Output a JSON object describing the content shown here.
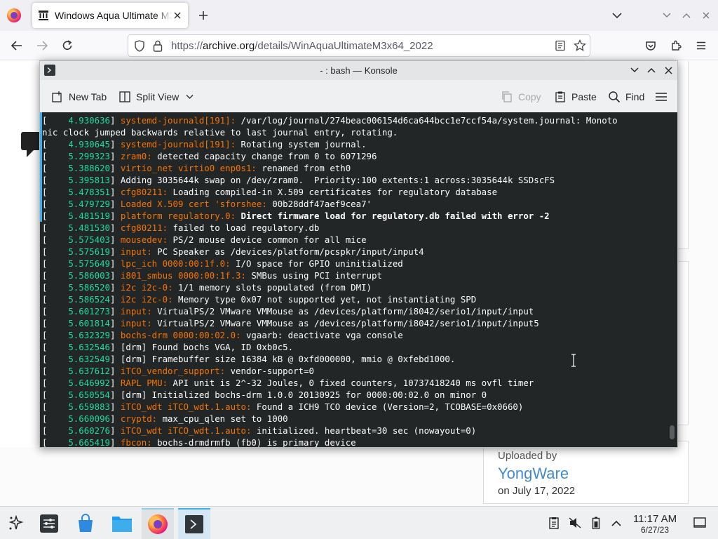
{
  "browser": {
    "tab_title": "Windows Aqua Ultimate M3x64_2022",
    "url_prefix": "https://",
    "url_domain": "archive.org",
    "url_path": "/details/WinAquaUltimateM3x64_2022"
  },
  "page": {
    "uploaded_by_label": "Uploaded by",
    "uploader": "YongWare",
    "upload_date": "on July 17, 2022"
  },
  "konsole": {
    "title": "- : bash — Konsole",
    "toolbar": {
      "new_tab": "New Tab",
      "split_view": "Split View",
      "copy": "Copy",
      "paste": "Paste",
      "find": "Find"
    },
    "lines": [
      [
        {
          "c": "w",
          "t": "[    "
        },
        {
          "c": "g",
          "t": "4.930636"
        },
        {
          "c": "w",
          "t": "] "
        },
        {
          "c": "o",
          "t": "systemd-journald[191]:"
        },
        {
          "c": "w",
          "t": " /var/log/journal/274beac006154d6ca644bcc1e7ccf54a/system.journal: Monoto"
        }
      ],
      [
        {
          "c": "w",
          "t": "nic clock jumped backwards relative to last journal entry, rotating."
        }
      ],
      [
        {
          "c": "w",
          "t": "[    "
        },
        {
          "c": "g",
          "t": "4.930645"
        },
        {
          "c": "w",
          "t": "] "
        },
        {
          "c": "o",
          "t": "systemd-journald[191]:"
        },
        {
          "c": "w",
          "t": " Rotating system journal."
        }
      ],
      [
        {
          "c": "w",
          "t": "[    "
        },
        {
          "c": "g",
          "t": "5.299323"
        },
        {
          "c": "w",
          "t": "] "
        },
        {
          "c": "o",
          "t": "zram0:"
        },
        {
          "c": "w",
          "t": " detected capacity change from 0 to 6071296"
        }
      ],
      [
        {
          "c": "w",
          "t": "[    "
        },
        {
          "c": "g",
          "t": "5.388620"
        },
        {
          "c": "w",
          "t": "] "
        },
        {
          "c": "o",
          "t": "virtio_net virtio0 enp0s1:"
        },
        {
          "c": "w",
          "t": " renamed from eth0"
        }
      ],
      [
        {
          "c": "w",
          "t": "[    "
        },
        {
          "c": "g",
          "t": "5.395813"
        },
        {
          "c": "w",
          "t": "] Adding 3035644k swap on /dev/zram0.  Priority:100 extents:1 across:3035644k SSDscFS"
        }
      ],
      [
        {
          "c": "w",
          "t": "[    "
        },
        {
          "c": "g",
          "t": "5.478351"
        },
        {
          "c": "w",
          "t": "] "
        },
        {
          "c": "o",
          "t": "cfg80211:"
        },
        {
          "c": "w",
          "t": " Loading compiled-in X.509 certificates for regulatory database"
        }
      ],
      [
        {
          "c": "w",
          "t": "[    "
        },
        {
          "c": "g",
          "t": "5.479729"
        },
        {
          "c": "w",
          "t": "] "
        },
        {
          "c": "o",
          "t": "Loaded X.509 cert 'sforshee:"
        },
        {
          "c": "w",
          "t": " 00b28ddf47aef9cea7'"
        }
      ],
      [
        {
          "c": "w",
          "t": "[    "
        },
        {
          "c": "g",
          "t": "5.481519"
        },
        {
          "c": "w",
          "t": "] "
        },
        {
          "c": "o",
          "t": "platform regulatory.0:"
        },
        {
          "c": "b",
          "t": " Direct firmware load for regulatory.db failed with error -2"
        }
      ],
      [
        {
          "c": "w",
          "t": "[    "
        },
        {
          "c": "g",
          "t": "5.481530"
        },
        {
          "c": "w",
          "t": "] "
        },
        {
          "c": "o",
          "t": "cfg80211:"
        },
        {
          "c": "w",
          "t": " failed to load regulatory.db"
        }
      ],
      [
        {
          "c": "w",
          "t": "[    "
        },
        {
          "c": "g",
          "t": "5.575403"
        },
        {
          "c": "w",
          "t": "] "
        },
        {
          "c": "o",
          "t": "mousedev:"
        },
        {
          "c": "w",
          "t": " PS/2 mouse device common for all mice"
        }
      ],
      [
        {
          "c": "w",
          "t": "[    "
        },
        {
          "c": "g",
          "t": "5.575619"
        },
        {
          "c": "w",
          "t": "] "
        },
        {
          "c": "o",
          "t": "input:"
        },
        {
          "c": "w",
          "t": " PC Speaker as /devices/platform/pcspkr/input/input4"
        }
      ],
      [
        {
          "c": "w",
          "t": "[    "
        },
        {
          "c": "g",
          "t": "5.575649"
        },
        {
          "c": "w",
          "t": "] "
        },
        {
          "c": "o",
          "t": "lpc_ich 0000:00:1f.0:"
        },
        {
          "c": "w",
          "t": " I/O space for GPIO uninitialized"
        }
      ],
      [
        {
          "c": "w",
          "t": "[    "
        },
        {
          "c": "g",
          "t": "5.586003"
        },
        {
          "c": "w",
          "t": "] "
        },
        {
          "c": "o",
          "t": "i801_smbus 0000:00:1f.3:"
        },
        {
          "c": "w",
          "t": " SMBus using PCI interrupt"
        }
      ],
      [
        {
          "c": "w",
          "t": "[    "
        },
        {
          "c": "g",
          "t": "5.586520"
        },
        {
          "c": "w",
          "t": "] "
        },
        {
          "c": "o",
          "t": "i2c i2c-0:"
        },
        {
          "c": "w",
          "t": " 1/1 memory slots populated (from DMI)"
        }
      ],
      [
        {
          "c": "w",
          "t": "[    "
        },
        {
          "c": "g",
          "t": "5.586524"
        },
        {
          "c": "w",
          "t": "] "
        },
        {
          "c": "o",
          "t": "i2c i2c-0:"
        },
        {
          "c": "w",
          "t": " Memory type 0x07 not supported yet, not instantiating SPD"
        }
      ],
      [
        {
          "c": "w",
          "t": "[    "
        },
        {
          "c": "g",
          "t": "5.601273"
        },
        {
          "c": "w",
          "t": "] "
        },
        {
          "c": "o",
          "t": "input:"
        },
        {
          "c": "w",
          "t": " VirtualPS/2 VMware VMMouse as /devices/platform/i8042/serio1/input/input"
        }
      ],
      [
        {
          "c": "w",
          "t": "[    "
        },
        {
          "c": "g",
          "t": "5.601814"
        },
        {
          "c": "w",
          "t": "] "
        },
        {
          "c": "o",
          "t": "input:"
        },
        {
          "c": "w",
          "t": " VirtualPS/2 VMware VMMouse as /devices/platform/i8042/serio1/input/input5"
        }
      ],
      [
        {
          "c": "w",
          "t": "[    "
        },
        {
          "c": "g",
          "t": "5.632329"
        },
        {
          "c": "w",
          "t": "] "
        },
        {
          "c": "o",
          "t": "bochs-drm 0000:00:02.0:"
        },
        {
          "c": "w",
          "t": " vgaarb: deactivate vga console"
        }
      ],
      [
        {
          "c": "w",
          "t": "[    "
        },
        {
          "c": "g",
          "t": "5.632546"
        },
        {
          "c": "w",
          "t": "] [drm] Found bochs VGA, ID 0xb0c5."
        }
      ],
      [
        {
          "c": "w",
          "t": "[    "
        },
        {
          "c": "g",
          "t": "5.632549"
        },
        {
          "c": "w",
          "t": "] [drm] Framebuffer size 16384 kB @ 0xfd000000, mmio @ 0xfebd1000."
        }
      ],
      [
        {
          "c": "w",
          "t": "[    "
        },
        {
          "c": "g",
          "t": "5.637612"
        },
        {
          "c": "w",
          "t": "] "
        },
        {
          "c": "o",
          "t": "iTCO_vendor_support:"
        },
        {
          "c": "w",
          "t": " vendor-support=0"
        }
      ],
      [
        {
          "c": "w",
          "t": "[    "
        },
        {
          "c": "g",
          "t": "5.646992"
        },
        {
          "c": "w",
          "t": "] "
        },
        {
          "c": "o",
          "t": "RAPL PMU:"
        },
        {
          "c": "w",
          "t": " API unit is 2^-32 Joules, 0 fixed counters, 10737418240 ms ovfl timer"
        }
      ],
      [
        {
          "c": "w",
          "t": "[    "
        },
        {
          "c": "g",
          "t": "5.650554"
        },
        {
          "c": "w",
          "t": "] [drm] Initialized bochs-drm 1.0.0 20130925 for 0000:00:02.0 on minor 0"
        }
      ],
      [
        {
          "c": "w",
          "t": "[    "
        },
        {
          "c": "g",
          "t": "5.659883"
        },
        {
          "c": "w",
          "t": "] "
        },
        {
          "c": "o",
          "t": "iTCO_wdt iTCO_wdt.1.auto:"
        },
        {
          "c": "w",
          "t": " Found a ICH9 TCO device (Version=2, TCOBASE=0x0660)"
        }
      ],
      [
        {
          "c": "w",
          "t": "[    "
        },
        {
          "c": "g",
          "t": "5.660096"
        },
        {
          "c": "w",
          "t": "] "
        },
        {
          "c": "o",
          "t": "cryptd:"
        },
        {
          "c": "w",
          "t": " max_cpu_qlen set to 1000"
        }
      ],
      [
        {
          "c": "w",
          "t": "[    "
        },
        {
          "c": "g",
          "t": "5.660276"
        },
        {
          "c": "w",
          "t": "] "
        },
        {
          "c": "o",
          "t": "iTCO_wdt iTCO_wdt.1.auto:"
        },
        {
          "c": "w",
          "t": " initialized. heartbeat=30 sec (nowayout=0)"
        }
      ],
      [
        {
          "c": "w",
          "t": "[    "
        },
        {
          "c": "g",
          "t": "5.665419"
        },
        {
          "c": "w",
          "t": "] "
        },
        {
          "c": "o",
          "t": "fbcon:"
        },
        {
          "c": "w",
          "t": " bochs-drmdrmfb (fb0) is primary device"
        }
      ]
    ]
  },
  "taskbar": {
    "time": "11:17 AM",
    "date": "6/27/23"
  },
  "icons": [
    "firefox-icon",
    "archive-favicon",
    "close-icon",
    "plus-icon",
    "chevron-down-icon",
    "minimize-icon",
    "maximize-icon",
    "back-icon",
    "forward-icon",
    "reload-icon",
    "shield-icon",
    "lock-icon",
    "reader-icon",
    "star-icon",
    "pocket-icon",
    "extensions-icon",
    "menu-icon",
    "terminal-icon",
    "new-tab-icon",
    "split-view-icon",
    "copy-icon",
    "paste-icon",
    "search-icon",
    "hamburger-icon",
    "text-cursor-icon",
    "app-launcher-icon",
    "settings-icon",
    "discover-icon",
    "folder-icon",
    "notes-icon",
    "volume-muted-icon",
    "battery-icon",
    "chevron-up-icon",
    "desktop-icon"
  ],
  "colors": {
    "timestamp": "#1cdc9a",
    "subsystem": "#f67400",
    "terminal_bg": "#232627",
    "accent": "#3daee9",
    "link": "#428bca"
  }
}
